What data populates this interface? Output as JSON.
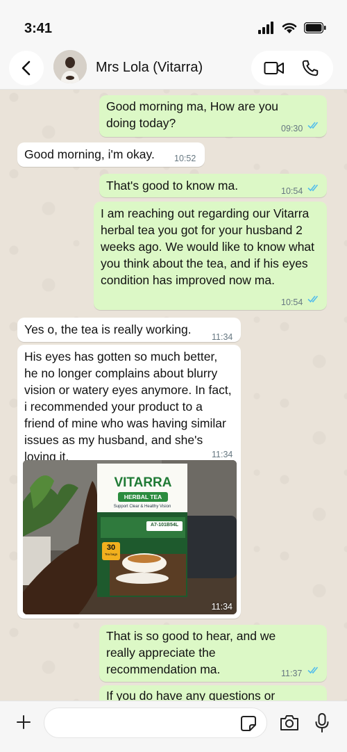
{
  "status_bar": {
    "time": "3:41"
  },
  "header": {
    "contact_name": "Mrs Lola (Vitarra)"
  },
  "messages": [
    {
      "text": "Good morning ma, How are you doing today?",
      "time": "09:30"
    },
    {
      "text": "Good morning, i'm okay.",
      "time": "10:52"
    },
    {
      "text": "That's good to know ma.",
      "time": "10:54"
    },
    {
      "text": "I am reaching out regarding our Vitarra herbal tea you got for your husband 2 weeks ago. We would like to know what you think about the tea, and if his eyes condition has improved now ma.",
      "time": "10:54"
    },
    {
      "text": "Yes o, the tea is really working.",
      "time": "11:34"
    },
    {
      "text": "His eyes has gotten so much better, he no longer complains about blurry vision or watery eyes anymore. In fact, i recommended your product to a friend of mine who was having similar issues as my husband, and she's loving it.",
      "time": "11:34"
    },
    {
      "text": "",
      "time": "11:34"
    },
    {
      "text": "That is so good to hear, and we really appreciate the recommendation ma.",
      "time": "11:37"
    },
    {
      "text": "If you do have any questions or",
      "time": ""
    }
  ],
  "product_box": {
    "brand": "VITARRA",
    "subtitle": "HERBAL TEA",
    "tagline": "Support Clear & Healthy Vision",
    "code": "A7-101B54L",
    "count": "30",
    "count_unit": "Tea bags"
  },
  "colors": {
    "outgoing_bubble": "#DCF8C6",
    "incoming_bubble": "#FFFFFF",
    "read_ticks": "#53BDEB",
    "chat_background": "#EAE3D9"
  },
  "composer": {
    "placeholder": ""
  }
}
